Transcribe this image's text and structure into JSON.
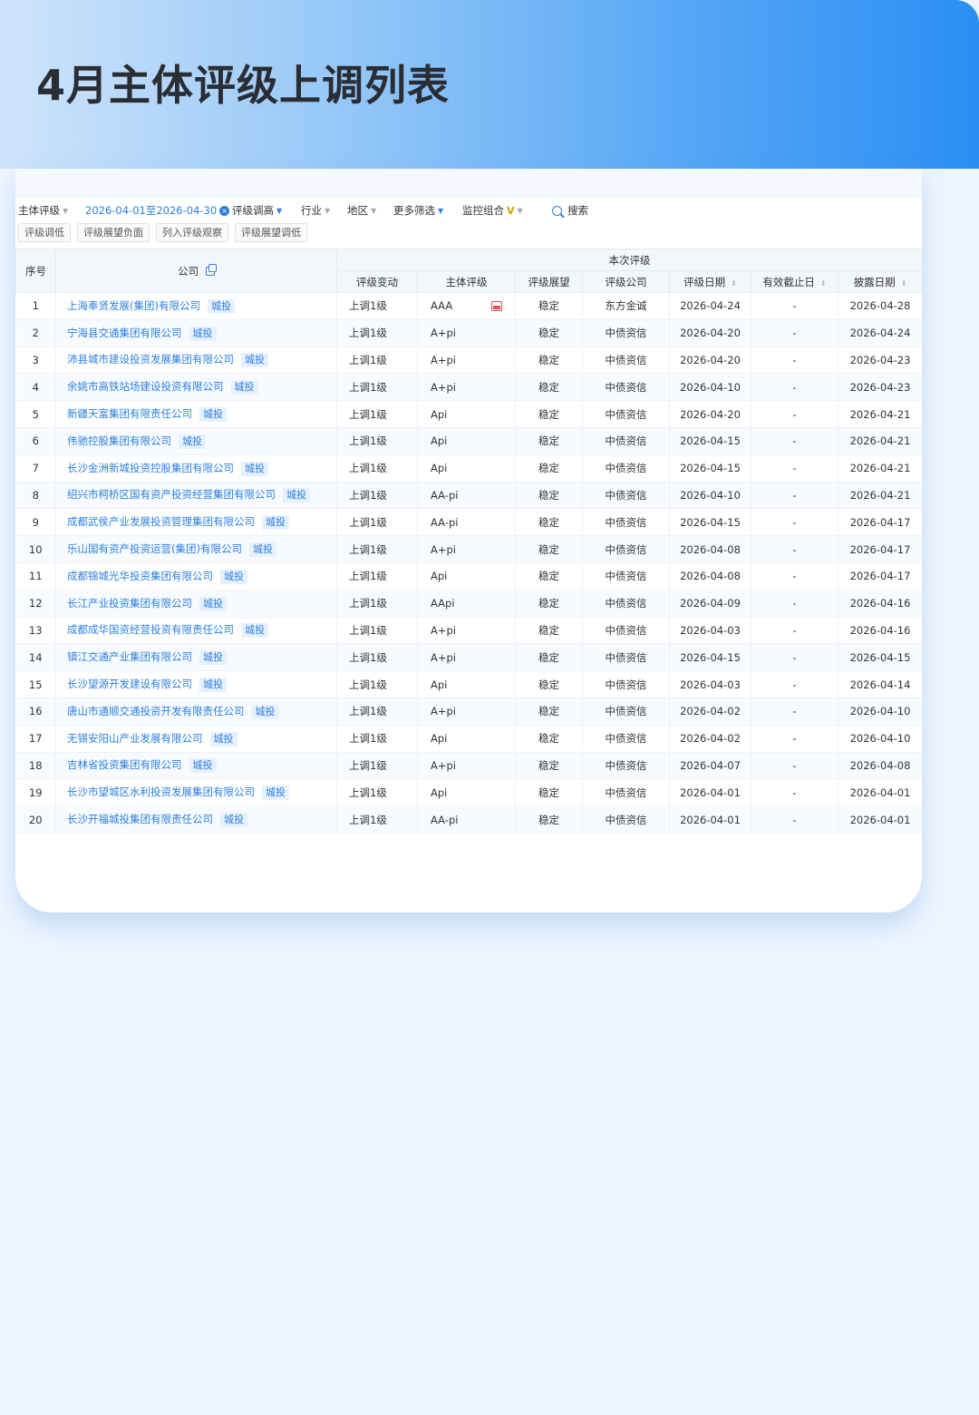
{
  "header": {
    "title": "4月主体评级上调列表"
  },
  "filters": {
    "subject_rating": "主体评级",
    "date_range": "2026-04-01至2026-04-30",
    "rating_up": "评级调高",
    "industry": "行业",
    "region": "地区",
    "more": "更多筛选",
    "monitor": "监控组合",
    "monitor_badge": "V",
    "search": "搜索"
  },
  "tags": [
    "评级调低",
    "评级展望负面",
    "列入评级观察",
    "评级展望调低"
  ],
  "table": {
    "headers": {
      "idx": "序号",
      "company": "公司",
      "group": "本次评级",
      "change": "评级变动",
      "rating": "主体评级",
      "outlook": "评级展望",
      "agency": "评级公司",
      "rating_date": "评级日期",
      "expiry": "有效截止日",
      "disclose": "披露日期"
    },
    "tag_label": "城投",
    "rows": [
      {
        "idx": "1",
        "company": "上海奉贤发展(集团)有限公司",
        "change": "上调1级",
        "rating": "AAA",
        "outlook": "稳定",
        "agency": "东方金诚",
        "date": "2026-04-24",
        "expiry": "-",
        "disclose": "2026-04-28"
      },
      {
        "idx": "2",
        "company": "宁海县交通集团有限公司",
        "change": "上调1级",
        "rating": "A+pi",
        "outlook": "稳定",
        "agency": "中债资信",
        "date": "2026-04-20",
        "expiry": "-",
        "disclose": "2026-04-24"
      },
      {
        "idx": "3",
        "company": "沛县城市建设投资发展集团有限公司",
        "change": "上调1级",
        "rating": "A+pi",
        "outlook": "稳定",
        "agency": "中债资信",
        "date": "2026-04-20",
        "expiry": "-",
        "disclose": "2026-04-23"
      },
      {
        "idx": "4",
        "company": "余姚市高铁站场建设投资有限公司",
        "change": "上调1级",
        "rating": "A+pi",
        "outlook": "稳定",
        "agency": "中债资信",
        "date": "2026-04-10",
        "expiry": "-",
        "disclose": "2026-04-23"
      },
      {
        "idx": "5",
        "company": "新疆天富集团有限责任公司",
        "change": "上调1级",
        "rating": "Api",
        "outlook": "稳定",
        "agency": "中债资信",
        "date": "2026-04-20",
        "expiry": "-",
        "disclose": "2026-04-21"
      },
      {
        "idx": "6",
        "company": "伟驰控股集团有限公司",
        "change": "上调1级",
        "rating": "Api",
        "outlook": "稳定",
        "agency": "中债资信",
        "date": "2026-04-15",
        "expiry": "-",
        "disclose": "2026-04-21"
      },
      {
        "idx": "7",
        "company": "长沙金洲新城投资控股集团有限公司",
        "change": "上调1级",
        "rating": "Api",
        "outlook": "稳定",
        "agency": "中债资信",
        "date": "2026-04-15",
        "expiry": "-",
        "disclose": "2026-04-21"
      },
      {
        "idx": "8",
        "company": "绍兴市柯桥区国有资产投资经营集团有限公司",
        "change": "上调1级",
        "rating": "AA-pi",
        "outlook": "稳定",
        "agency": "中债资信",
        "date": "2026-04-10",
        "expiry": "-",
        "disclose": "2026-04-21"
      },
      {
        "idx": "9",
        "company": "成都武侯产业发展投资管理集团有限公司",
        "change": "上调1级",
        "rating": "AA-pi",
        "outlook": "稳定",
        "agency": "中债资信",
        "date": "2026-04-15",
        "expiry": "-",
        "disclose": "2026-04-17"
      },
      {
        "idx": "10",
        "company": "乐山国有资产投资运营(集团)有限公司",
        "change": "上调1级",
        "rating": "A+pi",
        "outlook": "稳定",
        "agency": "中债资信",
        "date": "2026-04-08",
        "expiry": "-",
        "disclose": "2026-04-17"
      },
      {
        "idx": "11",
        "company": "成都锦城光华投资集团有限公司",
        "change": "上调1级",
        "rating": "Api",
        "outlook": "稳定",
        "agency": "中债资信",
        "date": "2026-04-08",
        "expiry": "-",
        "disclose": "2026-04-17"
      },
      {
        "idx": "12",
        "company": "长江产业投资集团有限公司",
        "change": "上调1级",
        "rating": "AApi",
        "outlook": "稳定",
        "agency": "中债资信",
        "date": "2026-04-09",
        "expiry": "-",
        "disclose": "2026-04-16"
      },
      {
        "idx": "13",
        "company": "成都成华国资经营投资有限责任公司",
        "change": "上调1级",
        "rating": "A+pi",
        "outlook": "稳定",
        "agency": "中债资信",
        "date": "2026-04-03",
        "expiry": "-",
        "disclose": "2026-04-16"
      },
      {
        "idx": "14",
        "company": "镇江交通产业集团有限公司",
        "change": "上调1级",
        "rating": "A+pi",
        "outlook": "稳定",
        "agency": "中债资信",
        "date": "2026-04-15",
        "expiry": "-",
        "disclose": "2026-04-15"
      },
      {
        "idx": "15",
        "company": "长沙望源开发建设有限公司",
        "change": "上调1级",
        "rating": "Api",
        "outlook": "稳定",
        "agency": "中债资信",
        "date": "2026-04-03",
        "expiry": "-",
        "disclose": "2026-04-14"
      },
      {
        "idx": "16",
        "company": "唐山市通顺交通投资开发有限责任公司",
        "change": "上调1级",
        "rating": "A+pi",
        "outlook": "稳定",
        "agency": "中债资信",
        "date": "2026-04-02",
        "expiry": "-",
        "disclose": "2026-04-10"
      },
      {
        "idx": "17",
        "company": "无锡安阳山产业发展有限公司",
        "change": "上调1级",
        "rating": "Api",
        "outlook": "稳定",
        "agency": "中债资信",
        "date": "2026-04-02",
        "expiry": "-",
        "disclose": "2026-04-10"
      },
      {
        "idx": "18",
        "company": "吉林省投资集团有限公司",
        "change": "上调1级",
        "rating": "A+pi",
        "outlook": "稳定",
        "agency": "中债资信",
        "date": "2026-04-07",
        "expiry": "-",
        "disclose": "2026-04-08"
      },
      {
        "idx": "19",
        "company": "长沙市望城区水利投资发展集团有限公司",
        "change": "上调1级",
        "rating": "Api",
        "outlook": "稳定",
        "agency": "中债资信",
        "date": "2026-04-01",
        "expiry": "-",
        "disclose": "2026-04-01"
      },
      {
        "idx": "20",
        "company": "长沙开福城投集团有限责任公司",
        "change": "上调1级",
        "rating": "AA-pi",
        "outlook": "稳定",
        "agency": "中债资信",
        "date": "2026-04-01",
        "expiry": "-",
        "disclose": "2026-04-01"
      }
    ]
  }
}
